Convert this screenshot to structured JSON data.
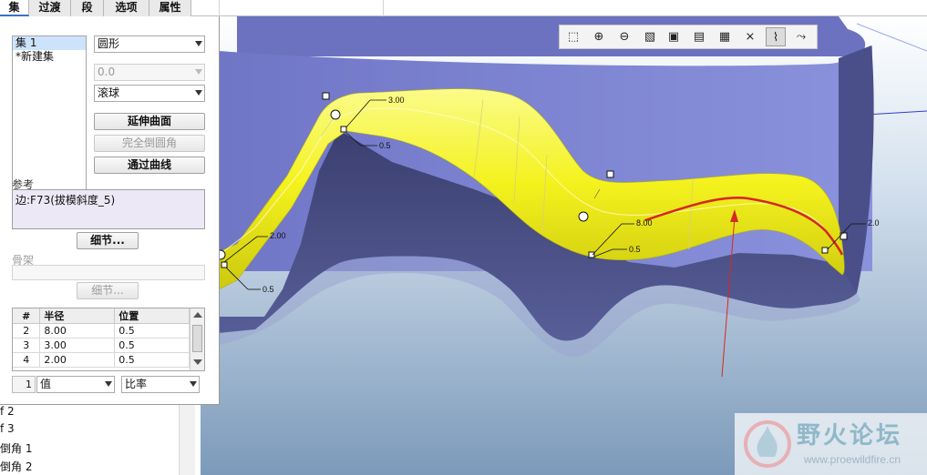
{
  "tabs": [
    "集",
    "过渡",
    "段",
    "选项",
    "属性"
  ],
  "sets": {
    "items": [
      "集 1",
      "*新建集"
    ],
    "selected_index": 0
  },
  "controls": {
    "shape_combo": "圆形",
    "value_combo": "0.0",
    "method_combo": "滚球",
    "extend_surfaces_button": "延伸曲面",
    "full_round_button": "完全倒圆角",
    "through_curve_button": "通过曲线"
  },
  "references": {
    "label": "参考",
    "value": "边:F73(拔模斜度_5)",
    "details_button": "细节..."
  },
  "spine": {
    "label": "骨架",
    "details_button": "细节..."
  },
  "radius_table": {
    "headers": [
      "#",
      "半径",
      "位置"
    ],
    "rows": [
      {
        "num": "2",
        "radius": "8.00",
        "position": "0.5"
      },
      {
        "num": "3",
        "radius": "3.00",
        "position": "0.5"
      },
      {
        "num": "4",
        "radius": "2.00",
        "position": "0.5"
      }
    ]
  },
  "bottom_row": {
    "index": "1",
    "value_combo": "值",
    "ratio_combo": "比率"
  },
  "tree_rows": [
    "f 2",
    "f 3",
    "倒角 1",
    "倒角 2"
  ],
  "viewport": {
    "dimensions": [
      "3.00",
      "0.5",
      "2.00",
      "0.5",
      "8.00",
      "0.5",
      "2.0"
    ],
    "colors": {
      "background_top": "#ffffff",
      "background_bottom": "#7e9cbb",
      "model_face": "#7f86d2",
      "model_side": "#4a4f84",
      "round_surface": "#f3f11a",
      "curve": "#d62a20",
      "arrow": "#d62a20"
    }
  },
  "toolbar_icons": [
    "zoom-fit-icon",
    "zoom-in-icon",
    "zoom-out-icon",
    "repaint-icon",
    "display-style-icon",
    "saved-views-icon",
    "camera-icon",
    "datum-axes-icon",
    "spin-center-icon",
    "annotation-icon"
  ],
  "watermark": {
    "title": "野火论坛",
    "url": "www.proewildfire.cn"
  }
}
